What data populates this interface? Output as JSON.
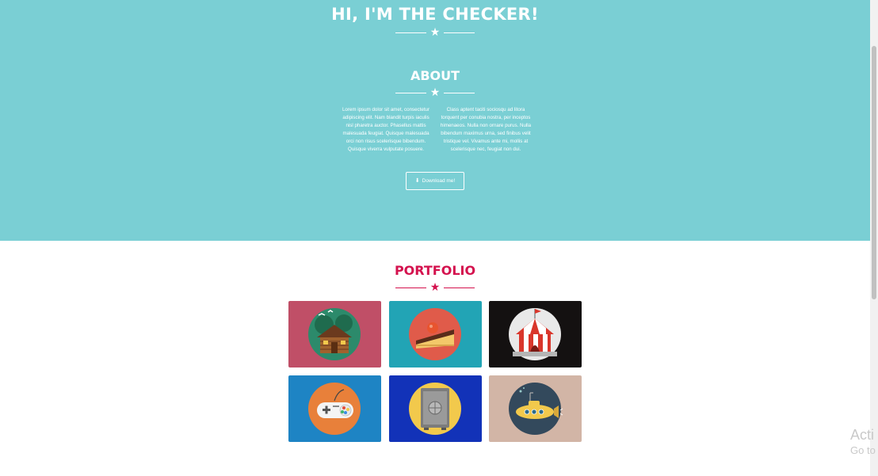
{
  "hero": {
    "title": "HI, I'M THE CHECKER!",
    "background": "#7acfd4"
  },
  "about": {
    "title": "ABOUT",
    "column_left": "Lorem ipsum dolor sit amet, consectetur adipiscing elit. Nam blandit turpis iaculis nisl pharetra auctor. Phasellus mattis malesuada feugiat. Quisque malesuada orci non risus scelerisque bibendum. Quisque viverra vulputate posuere.",
    "column_right": "Class aptent taciti sociosqu ad litora torquent per conubia nostra, per inceptos himenaeos. Nulla non ornare purus. Nulla bibendum maximus urna, sed finibus velit tristique vel. Vivamus ante mi, mollis at scelerisque nec, feugiat non dui.",
    "download_label": "Download me!",
    "download_icon": "download-icon"
  },
  "portfolio": {
    "title": "PORTFOLIO",
    "accent": "#d4124e",
    "items": [
      {
        "name": "cabin",
        "icon": "log-cabin-icon",
        "color": "#c04f67"
      },
      {
        "name": "cake",
        "icon": "cake-slice-icon",
        "color": "#22a4b5"
      },
      {
        "name": "circus",
        "icon": "circus-tent-icon",
        "color": "#141111"
      },
      {
        "name": "game",
        "icon": "gamepad-icon",
        "color": "#1e84c4"
      },
      {
        "name": "safe",
        "icon": "safe-icon",
        "color": "#1232b8"
      },
      {
        "name": "submarine",
        "icon": "submarine-icon",
        "color": "#d2b5a6"
      }
    ]
  },
  "watermark": {
    "line1": "Acti",
    "line2": "Go to"
  }
}
